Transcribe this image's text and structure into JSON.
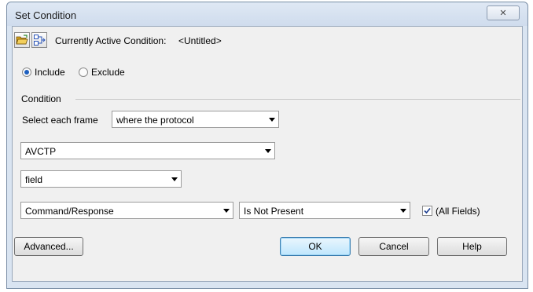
{
  "window": {
    "title": "Set Condition",
    "close_glyph": "✕"
  },
  "toolbar": {
    "open_icon": "open-folder-icon",
    "edit_icon": "expression-icon",
    "active_condition_label": "Currently Active Condition:",
    "active_condition_value": "<Untitled>"
  },
  "mode": {
    "include_label": "Include",
    "exclude_label": "Exclude",
    "selected": "Include"
  },
  "condition": {
    "group_label": "Condition",
    "select_label": "Select each frame",
    "frame_selector_value": "where the protocol",
    "protocol_value": "AVCTP",
    "scope_value": "field",
    "field_value": "Command/Response",
    "operator_value": "Is Not Present",
    "all_fields_label": "(All Fields)",
    "all_fields_checked": true
  },
  "buttons": {
    "advanced": "Advanced...",
    "ok": "OK",
    "cancel": "Cancel",
    "help": "Help"
  }
}
